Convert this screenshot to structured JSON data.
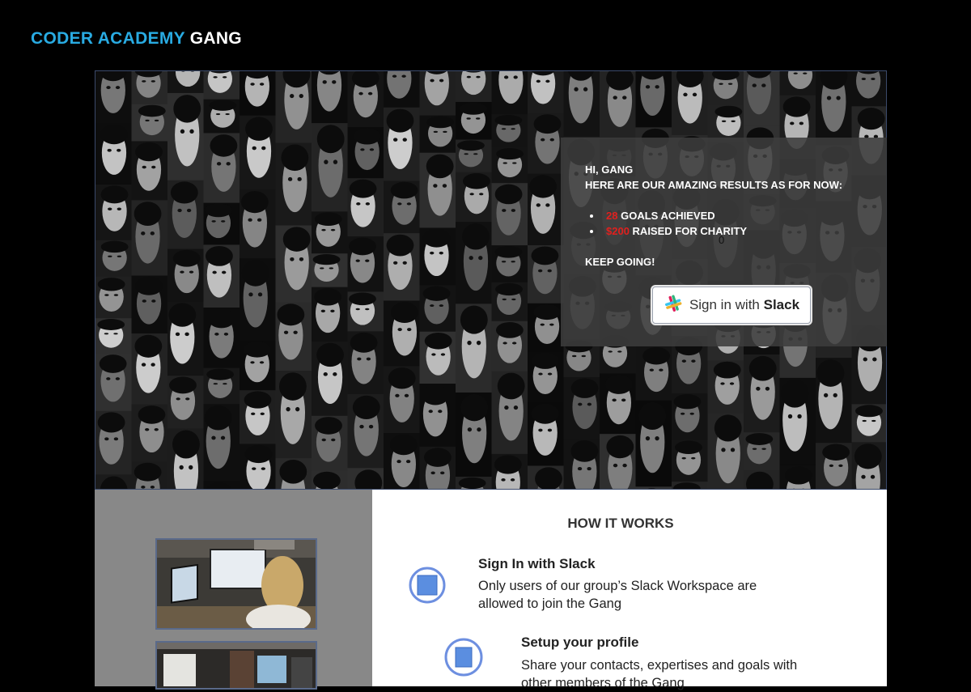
{
  "brand": {
    "part1": "CODER ACADEMY",
    "part2": "GANG"
  },
  "hero": {
    "greeting": "HI, GANG",
    "intro": "HERE ARE OUR AMAZING RESULTS AS FOR NOW:",
    "stats": [
      {
        "value": "28",
        "label": "GOALS ACHIEVED"
      },
      {
        "value": "$200",
        "label": "RAISED FOR CHARITY"
      }
    ],
    "stray_char": "0",
    "closing": "KEEP GOING!",
    "signin": {
      "prefix": "Sign in with",
      "brand": "Slack"
    }
  },
  "how_it_works": {
    "title": "HOW IT WORKS",
    "steps": [
      {
        "title": "Sign In with Slack",
        "line1": "Only users of our group’s Slack Workspace are",
        "line2": "allowed to join the Gang"
      },
      {
        "title": "Setup your profile",
        "line1": "Share your contacts, expertises and goals with",
        "line2": "other members of the Gang"
      }
    ]
  },
  "colors": {
    "brand_blue": "#29abe2",
    "highlight_red": "#e0201e",
    "panel_gray": "#888888"
  }
}
